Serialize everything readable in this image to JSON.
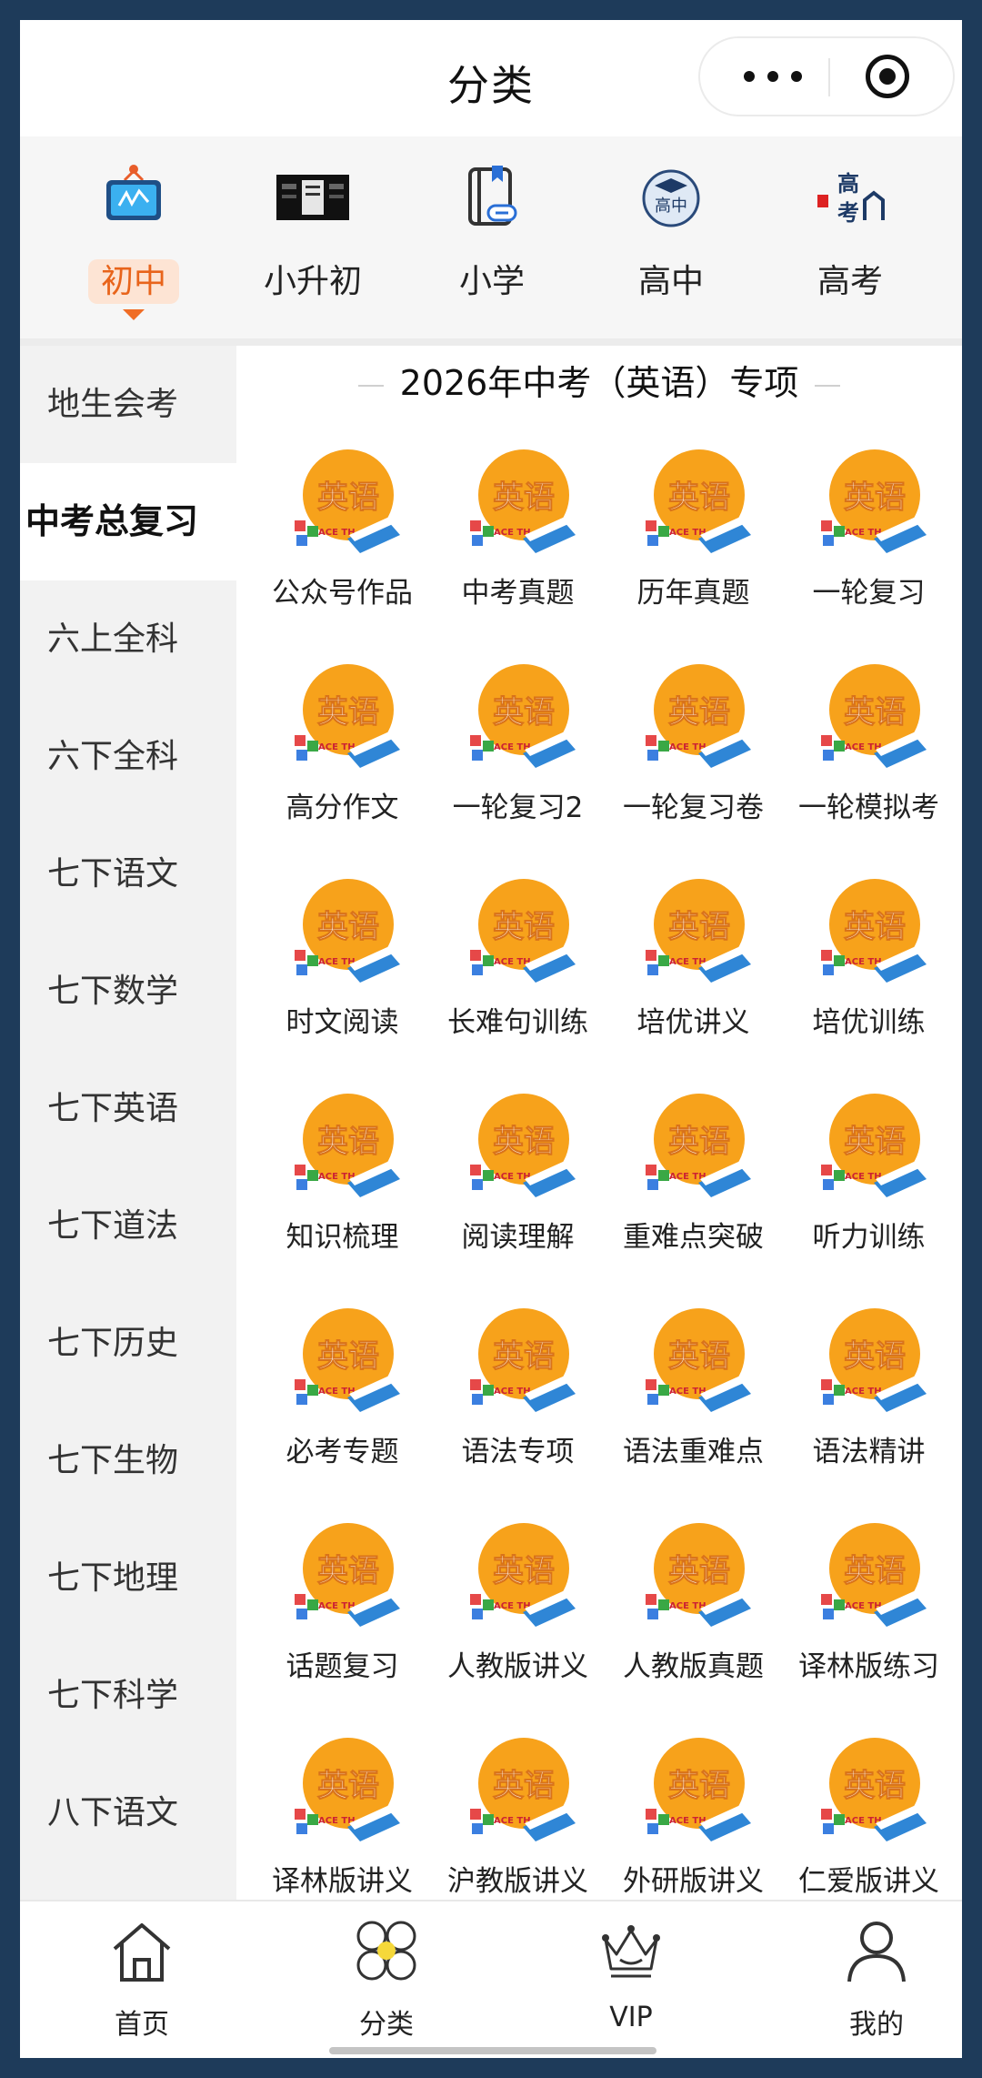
{
  "header": {
    "title": "分类"
  },
  "levels": [
    {
      "label": "初中",
      "icon": "whiteboard-icon",
      "active": true
    },
    {
      "label": "小升初",
      "icon": "banner-icon",
      "active": false
    },
    {
      "label": "小学",
      "icon": "book-link-icon",
      "active": false
    },
    {
      "label": "高中",
      "icon": "grad-cap-icon",
      "active": false
    },
    {
      "label": "高考",
      "icon": "gaokao-icon",
      "active": false
    }
  ],
  "sidebar": {
    "items": [
      "地生会考",
      "中考总复习",
      "六上全科",
      "六下全科",
      "七下语文",
      "七下数学",
      "七下英语",
      "七下道法",
      "七下历史",
      "七下生物",
      "七下地理",
      "七下科学",
      "八下语文"
    ],
    "active_index": 1
  },
  "section": {
    "title": "2026年中考（英语）专项"
  },
  "tile_badge": "英语",
  "tile_badge_side": "ACE TH",
  "tiles": [
    "公众号作品",
    "中考真题",
    "历年真题",
    "一轮复习",
    "高分作文",
    "一轮复习2",
    "一轮复习卷",
    "一轮模拟考",
    "时文阅读",
    "长难句训练",
    "培优讲义",
    "培优训练",
    "知识梳理",
    "阅读理解",
    "重难点突破",
    "听力训练",
    "必考专题",
    "语法专项",
    "语法重难点",
    "语法精讲",
    "话题复习",
    "人教版讲义",
    "人教版真题",
    "译林版练习",
    "译林版讲义",
    "沪教版讲义",
    "外研版讲义",
    "仁爱版讲义"
  ],
  "bottom_nav": [
    {
      "label": "首页",
      "icon": "home-icon",
      "active": false
    },
    {
      "label": "分类",
      "icon": "category-icon",
      "active": true
    },
    {
      "label": "VIP",
      "icon": "crown-icon",
      "active": false
    },
    {
      "label": "我的",
      "icon": "user-icon",
      "active": false
    }
  ],
  "colors": {
    "accent": "#e8641b",
    "nav_active": "#e8c53a",
    "tile_circle": "#f7a21b",
    "book": "#2f86d6"
  }
}
